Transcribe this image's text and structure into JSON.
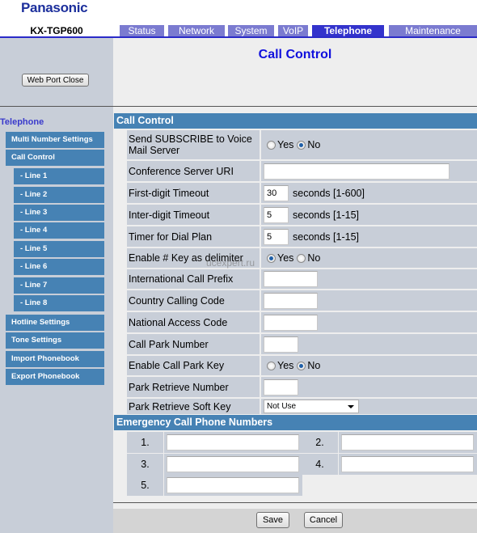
{
  "header": {
    "brand": "Panasonic",
    "model": "KX-TGP600",
    "tabs": [
      {
        "label": "Status",
        "active": false
      },
      {
        "label": "Network",
        "active": false
      },
      {
        "label": "System",
        "active": false
      },
      {
        "label": "VoIP",
        "active": false
      },
      {
        "label": "Telephone",
        "active": true
      },
      {
        "label": "Maintenance",
        "active": false
      }
    ]
  },
  "sidebar": {
    "web_port_close": "Web Port Close",
    "section_title": "Telephone",
    "items": [
      {
        "label": "Multi Number Settings"
      },
      {
        "label": "Call Control"
      },
      {
        "label": "- Line 1"
      },
      {
        "label": "- Line 2"
      },
      {
        "label": "- Line 3"
      },
      {
        "label": "- Line 4"
      },
      {
        "label": "- Line 5"
      },
      {
        "label": "- Line 6"
      },
      {
        "label": "- Line 7"
      },
      {
        "label": "- Line 8"
      },
      {
        "label": "Hotline Settings"
      },
      {
        "label": "Tone Settings"
      },
      {
        "label": "Import Phonebook"
      },
      {
        "label": "Export Phonebook"
      }
    ]
  },
  "main": {
    "page_title": "Call Control",
    "section_call_control": "Call Control",
    "watermark": "ucexpert.ru",
    "radio_yes": "Yes",
    "radio_no": "No",
    "fields": {
      "send_subscribe": {
        "label": "Send SUBSCRIBE to Voice Mail Server",
        "value": "No"
      },
      "conference_uri": {
        "label": "Conference Server URI",
        "value": ""
      },
      "first_digit": {
        "label": "First-digit Timeout",
        "value": "30",
        "unit": "seconds [1-600]"
      },
      "inter_digit": {
        "label": "Inter-digit Timeout",
        "value": "5",
        "unit": "seconds [1-15]"
      },
      "dial_plan_timer": {
        "label": "Timer for Dial Plan",
        "value": "5",
        "unit": "seconds [1-15]"
      },
      "hash_delimiter": {
        "label": "Enable # Key as delimiter",
        "value": "Yes"
      },
      "intl_prefix": {
        "label": "International Call Prefix",
        "value": ""
      },
      "country_code": {
        "label": "Country Calling Code",
        "value": ""
      },
      "national_access": {
        "label": "National Access Code",
        "value": ""
      },
      "call_park_number": {
        "label": "Call Park Number",
        "value": ""
      },
      "call_park_key": {
        "label": "Enable Call Park Key",
        "value": "No"
      },
      "park_retrieve_number": {
        "label": "Park Retrieve Number",
        "value": ""
      },
      "park_retrieve_softkey": {
        "label": "Park Retrieve Soft Key",
        "value": "Not Use"
      }
    },
    "section_emergency": "Emergency Call Phone Numbers",
    "emergency": [
      {
        "label": "1.",
        "value": ""
      },
      {
        "label": "2.",
        "value": ""
      },
      {
        "label": "3.",
        "value": ""
      },
      {
        "label": "4.",
        "value": ""
      },
      {
        "label": "5.",
        "value": ""
      }
    ],
    "save": "Save",
    "cancel": "Cancel"
  }
}
